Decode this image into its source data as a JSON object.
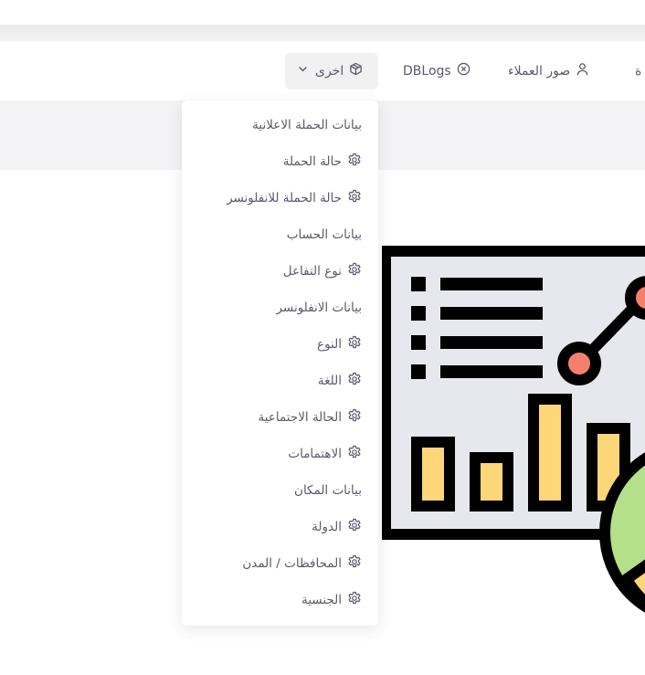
{
  "navbar": {
    "first_label": "ة",
    "customer_photos": "صور العملاء",
    "dblogs": "DBLogs",
    "other": "اخرى"
  },
  "dropdown": {
    "items": [
      {
        "label": "بيانات الحملة الاعلانية",
        "icon": "none"
      },
      {
        "label": "حالة الحملة",
        "icon": "gear-icon"
      },
      {
        "label": "حالة الحملة للانفلونسر",
        "icon": "gear-icon"
      },
      {
        "label": "بيانات الحساب",
        "icon": "none"
      },
      {
        "label": "نوع التفاعل",
        "icon": "gear-icon"
      },
      {
        "label": "بيانات الانفلونسر",
        "icon": "none"
      },
      {
        "label": "النوع",
        "icon": "gear-icon"
      },
      {
        "label": "اللغة",
        "icon": "gear-icon"
      },
      {
        "label": "الحالة الاجتماعية",
        "icon": "gear-icon"
      },
      {
        "label": "الاهتمامات",
        "icon": "gear-icon"
      },
      {
        "label": "بيانات المكان",
        "icon": "none"
      },
      {
        "label": "الدولة",
        "icon": "gear-icon"
      },
      {
        "label": "المحافظات / المدن",
        "icon": "gear-icon"
      },
      {
        "label": "الجنسية",
        "icon": "gear-icon"
      }
    ]
  },
  "colors": {
    "text": "#5d596c",
    "illustration_outline": "#000000",
    "illustration_bg": "#e6e8ee",
    "bar_fill": "#fcd678",
    "dot_fill": "#f4806c",
    "pie_fill": "#b4e08a"
  }
}
